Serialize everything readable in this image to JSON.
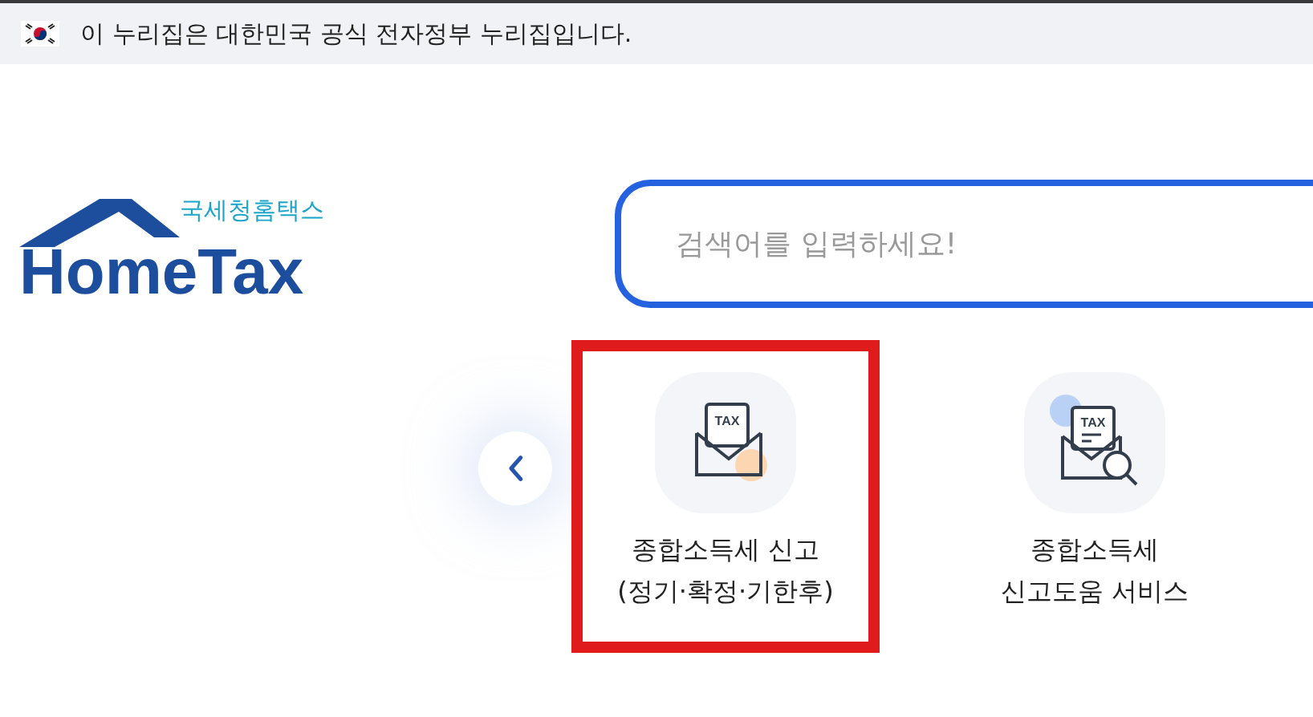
{
  "banner": {
    "text": "이 누리집은 대한민국 공식 전자정부 누리집입니다."
  },
  "logo": {
    "subtitle": "국세청홈택스",
    "title": "HomeTax"
  },
  "search": {
    "placeholder": "검색어를 입력하세요!"
  },
  "services": [
    {
      "kind": "envelope",
      "icon_label": "TAX",
      "lines": [
        "종합소득세 신고",
        "(정기·확정·기한후)"
      ],
      "highlighted": true
    },
    {
      "kind": "envelope-search",
      "icon_label": "TAX",
      "lines": [
        "종합소득세",
        "신고도움 서비스"
      ],
      "highlighted": false
    }
  ]
}
